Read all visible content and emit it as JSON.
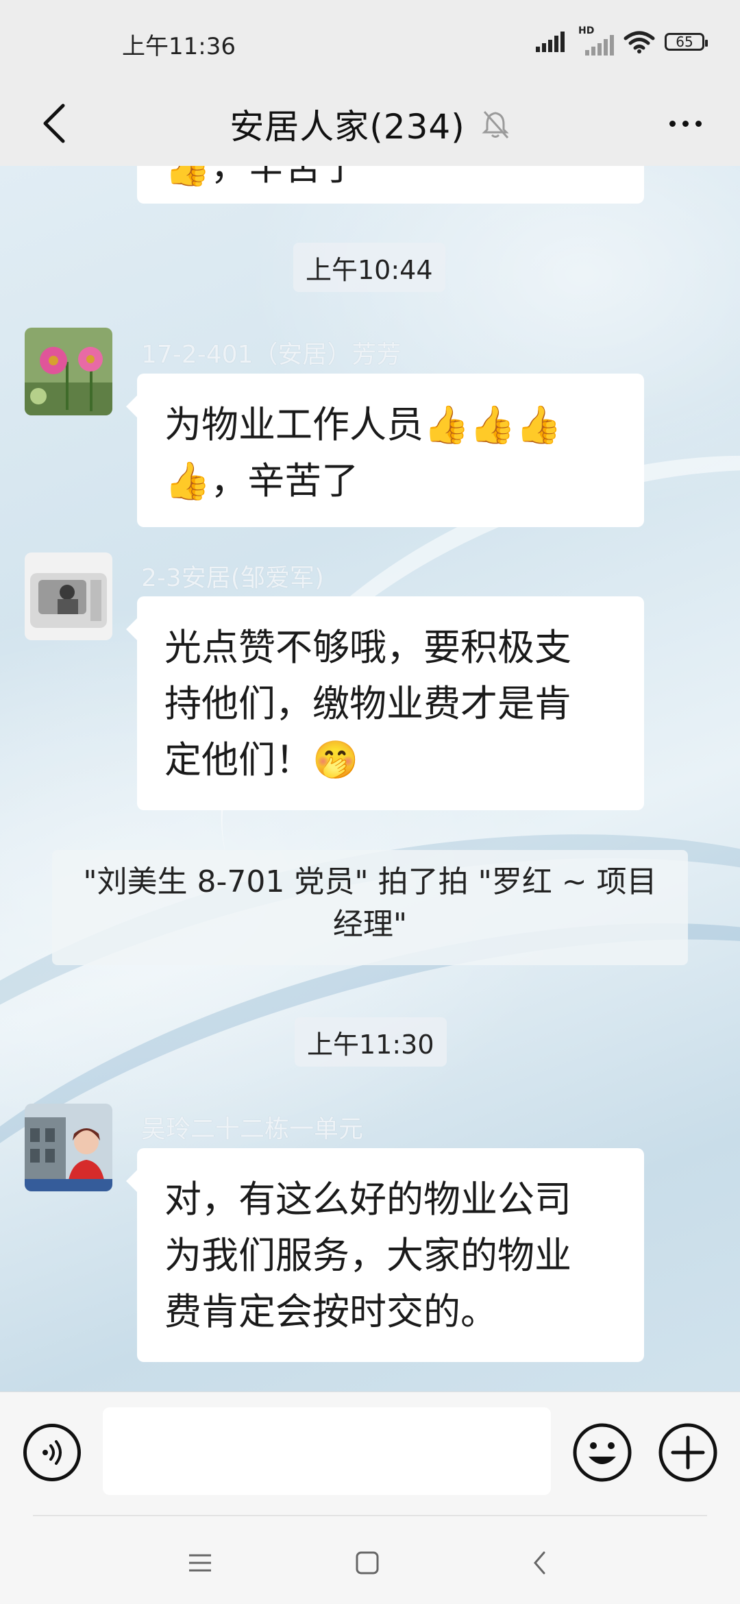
{
  "status_bar": {
    "time": "上午11:36",
    "battery": "65",
    "hd_label": "HD"
  },
  "header": {
    "title": "安居人家(234)"
  },
  "messages": [
    {
      "type": "partial_bubble",
      "text": "👍，辛苦了"
    },
    {
      "type": "time",
      "text": "上午10:44"
    },
    {
      "type": "message",
      "sender": "17-2-401（安居）芳芳",
      "line1": "为物业工作人员👍👍👍",
      "line2": "👍，辛苦了"
    },
    {
      "type": "message",
      "sender": "2-3安居(邹爱军)",
      "lines": [
        "光点赞不够哦，要积极支",
        "持他们，缴物业费才是肯",
        "定他们！🤭"
      ]
    },
    {
      "type": "system",
      "line1": "\"刘美生 8-701 党员\" 拍了拍 \"罗红 ~ 项目",
      "line2": "经理\""
    },
    {
      "type": "time",
      "text": "上午11:30"
    },
    {
      "type": "message",
      "sender": "吴玲二十二栋一单元",
      "lines": [
        "对，有这么好的物业公司",
        "为我们服务，大家的物业",
        "费肯定会按时交的。"
      ]
    }
  ],
  "input": {
    "placeholder": ""
  },
  "icons": {
    "back": "back-arrow-icon",
    "mute": "bell-off-icon",
    "more": "more-icon",
    "voice": "voice-icon",
    "emoji": "smiley-icon",
    "plus": "plus-icon",
    "nav_menu": "menu-icon",
    "nav_home": "square-icon",
    "nav_back": "chevron-left-icon"
  }
}
